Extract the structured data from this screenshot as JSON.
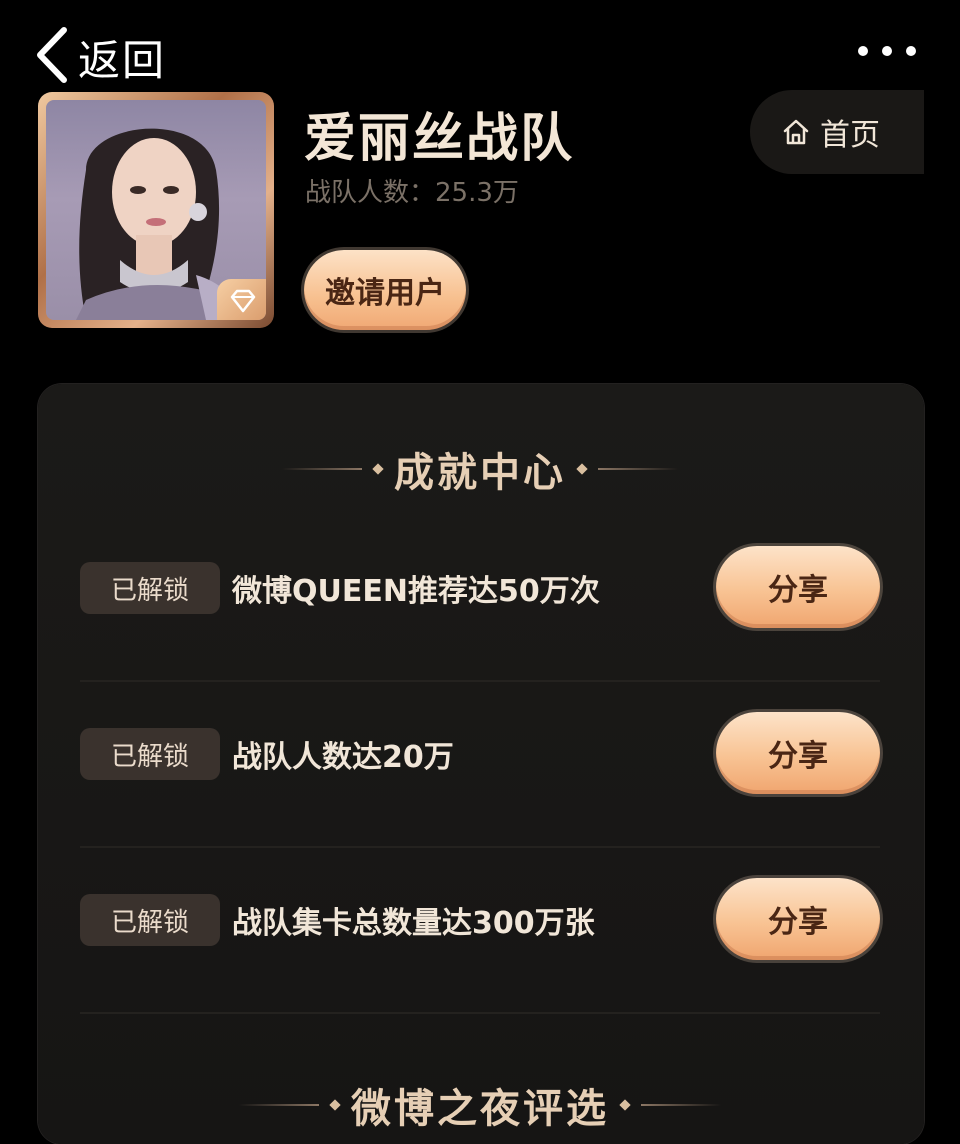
{
  "nav": {
    "back_label": "返回",
    "home_label": "首页"
  },
  "team": {
    "name": "爱丽丝战队",
    "member_count_label": "战队人数：",
    "member_count": "25.3万",
    "invite_label": "邀请用户"
  },
  "achievements": {
    "title": "成就中心",
    "items": [
      {
        "status": "已解锁",
        "text": "微博QUEEN推荐达50万次",
        "action": "分享"
      },
      {
        "status": "已解锁",
        "text": "战队人数达20万",
        "action": "分享"
      },
      {
        "status": "已解锁",
        "text": "战队集卡总数量达300万张",
        "action": "分享"
      }
    ]
  },
  "next_section": {
    "title": "微博之夜评选"
  },
  "colors": {
    "background": "#000000",
    "card": "#1b1a18",
    "accent_button": "#f8c393",
    "badge": "#3a322d"
  },
  "icons": {
    "back": "chevron-left-icon",
    "more": "more-dots-icon",
    "home": "home-icon",
    "diamond": "diamond-icon"
  }
}
